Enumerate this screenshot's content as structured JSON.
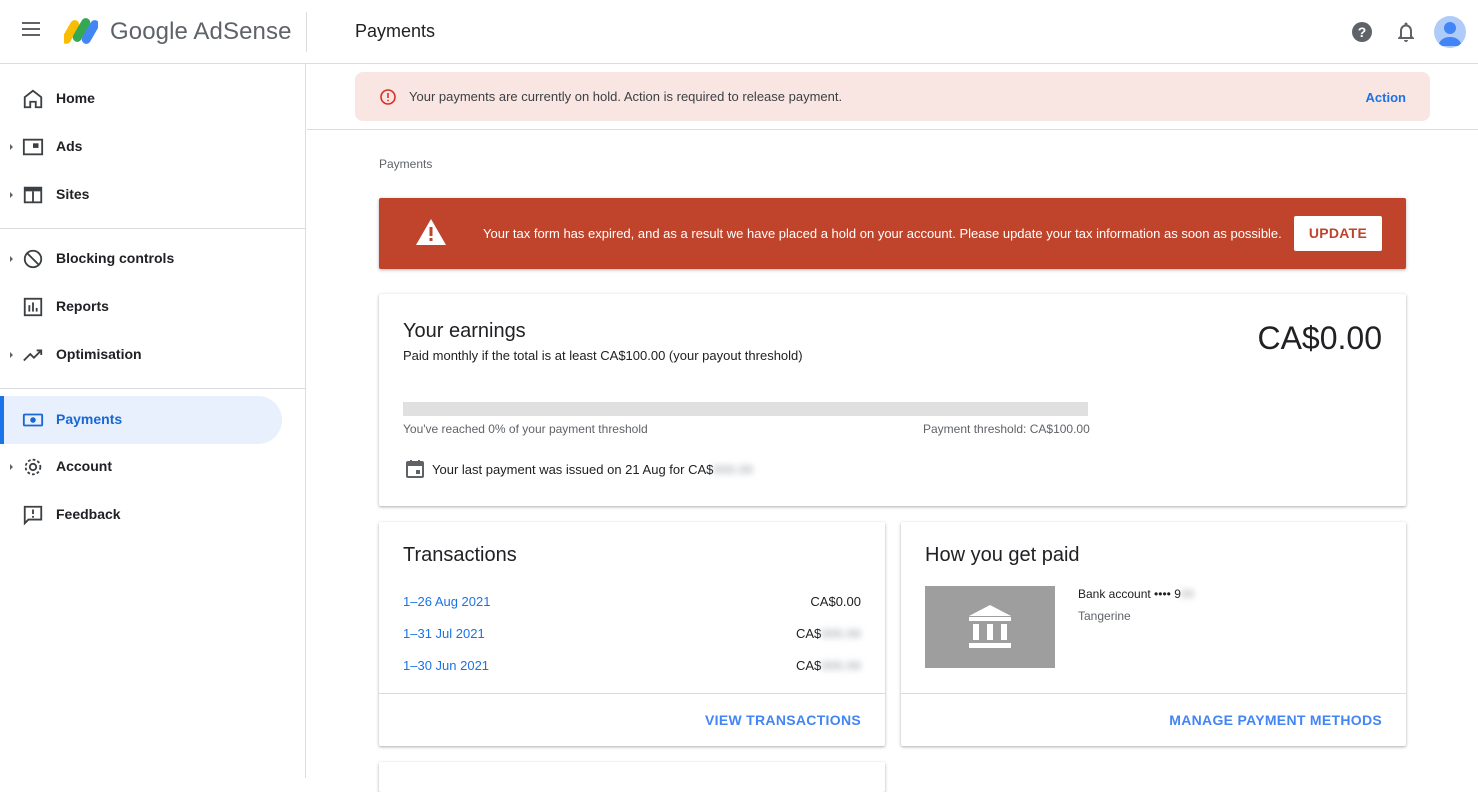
{
  "header": {
    "brand": "Google AdSense",
    "page_title": "Payments",
    "icons": [
      "help-icon",
      "notifications-icon",
      "account-avatar"
    ]
  },
  "sidebar": {
    "items": [
      {
        "label": "Home",
        "icon": "home-icon",
        "expandable": false
      },
      {
        "label": "Ads",
        "icon": "ads-icon",
        "expandable": true
      },
      {
        "label": "Sites",
        "icon": "sites-icon",
        "expandable": true
      },
      {
        "label": "Blocking controls",
        "icon": "block-icon",
        "expandable": true
      },
      {
        "label": "Reports",
        "icon": "reports-icon",
        "expandable": false
      },
      {
        "label": "Optimisation",
        "icon": "trending-icon",
        "expandable": true
      },
      {
        "label": "Payments",
        "icon": "payments-icon",
        "expandable": false,
        "active": true
      },
      {
        "label": "Account",
        "icon": "gear-icon",
        "expandable": true
      },
      {
        "label": "Feedback",
        "icon": "feedback-icon",
        "expandable": false
      }
    ]
  },
  "hold_banner": {
    "text": "Your payments are currently on hold. Action is required to release payment.",
    "action": "Action"
  },
  "breadcrumb": "Payments",
  "tax_banner": {
    "text": "Your tax form has expired, and as a result we have placed a hold on your account. Please update your tax information as soon as possible.",
    "button": "UPDATE"
  },
  "earnings": {
    "title": "Your earnings",
    "subtitle": "Paid monthly if the total is at least CA$100.00 (your payout threshold)",
    "amount": "CA$0.00",
    "progress_percent": 0,
    "progress_left": "You've reached 0% of your payment threshold",
    "progress_right": "Payment threshold: CA$100.00",
    "last_payment_prefix": "Your last payment was issued on 21 Aug for CA$",
    "last_payment_redacted": "000.00"
  },
  "transactions": {
    "title": "Transactions",
    "rows": [
      {
        "date": "1–26 Aug 2021",
        "amount": "CA$0.00",
        "redacted": ""
      },
      {
        "date": "1–31 Jul 2021",
        "amount": "CA$",
        "redacted": "000.00"
      },
      {
        "date": "1–30 Jun 2021",
        "amount": "CA$",
        "redacted": "000.00"
      }
    ],
    "link": "VIEW TRANSACTIONS"
  },
  "payment_method": {
    "title": "How you get paid",
    "account_prefix": "Bank account •••• 9",
    "account_redacted": "00",
    "provider": "Tangerine",
    "link": "MANAGE PAYMENT METHODS"
  },
  "colors": {
    "accent": "#1a73e8",
    "alert_red": "#c0432b",
    "hold_bg": "#f9e6e3",
    "active_nav_bg": "#e8f0fe"
  }
}
